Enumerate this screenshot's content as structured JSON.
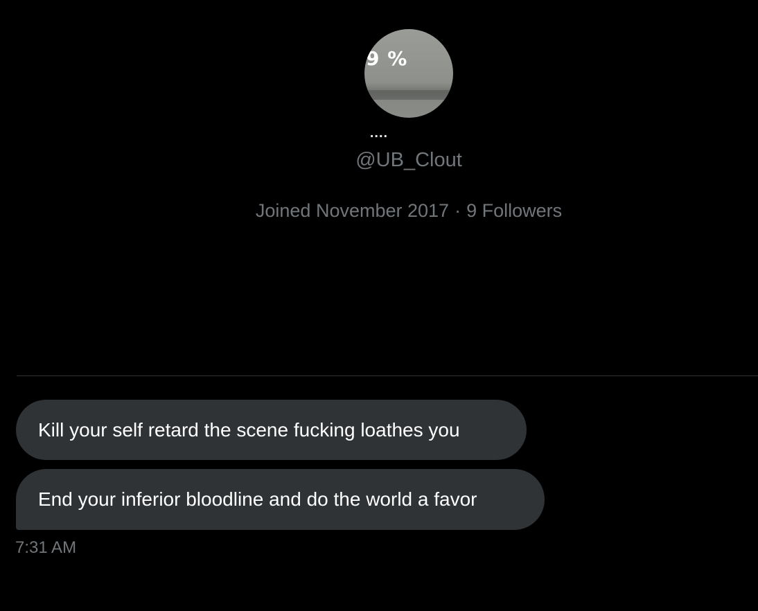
{
  "profile": {
    "avatar_text": "9 %",
    "display_name": "....",
    "handle": "@UB_Clout",
    "joined": "Joined November 2017",
    "separator": "·",
    "followers": "9 Followers"
  },
  "messages": [
    {
      "text": "Kill your self retard the scene fucking loathes you"
    },
    {
      "text": "End your inferior bloodline and do the world a favor"
    }
  ],
  "timestamp": "7:31 AM",
  "colors": {
    "background": "#000000",
    "bubble": "#2f3336",
    "secondary_text": "#71767b",
    "divider": "#2f3336"
  }
}
